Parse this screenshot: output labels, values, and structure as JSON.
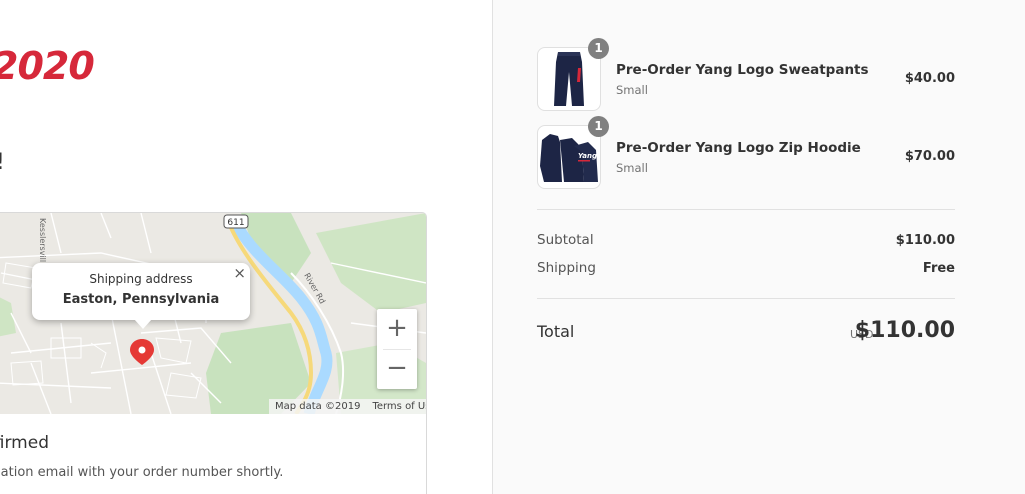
{
  "brand": {
    "logo_text": "2020",
    "color": "#d6283a"
  },
  "thanks": {
    "text": "!"
  },
  "map": {
    "popup_label": "Shipping address",
    "popup_city": "Easton, Pennsylvania",
    "close_glyph": "×",
    "zoom_in": "+",
    "zoom_out": "−",
    "attribution": "Map data ©2019",
    "terms": "Terms of Use",
    "route_badge": "611",
    "road_labels": [
      "Kesslersvill",
      "River Rd",
      "Ri"
    ]
  },
  "confirmation": {
    "title": "nfirmed",
    "text": "mation email with your order number shortly."
  },
  "cart": {
    "items": [
      {
        "name": "Pre-Order Yang Logo Sweatpants",
        "variant": "Small",
        "quantity": "1",
        "price": "$40.00"
      },
      {
        "name": "Pre-Order Yang Logo Zip Hoodie",
        "variant": "Small",
        "quantity": "1",
        "price": "$70.00"
      }
    ],
    "subtotal_label": "Subtotal",
    "subtotal_value": "$110.00",
    "shipping_label": "Shipping",
    "shipping_value": "Free",
    "total_label": "Total",
    "currency": "USD",
    "total_value": "$110.00"
  }
}
